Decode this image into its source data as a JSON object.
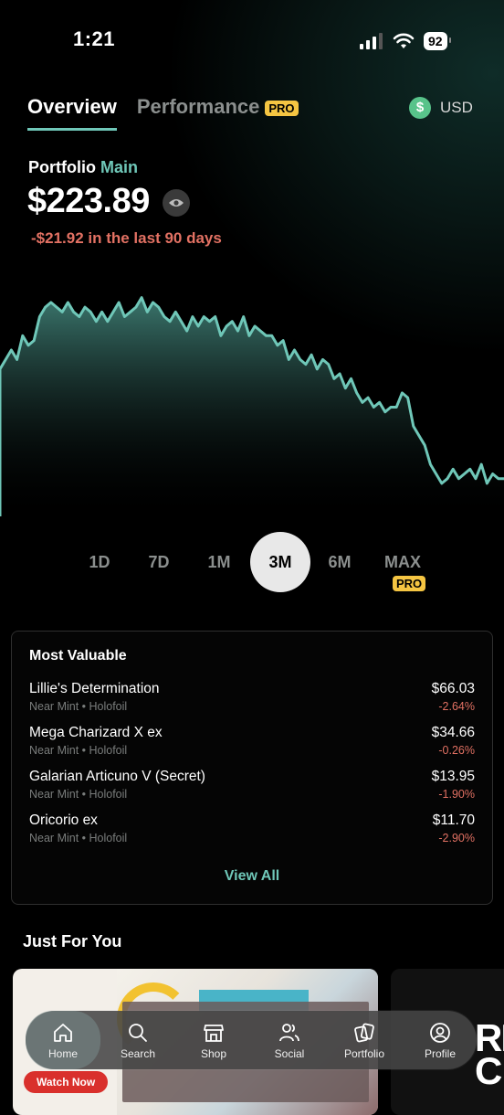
{
  "status_bar": {
    "time": "1:21",
    "battery": "92"
  },
  "tabs": [
    {
      "label": "Overview",
      "active": true
    },
    {
      "label": "Performance",
      "badge": "PRO",
      "active": false
    }
  ],
  "currency": {
    "icon": "dollar-icon",
    "symbol": "$",
    "label": "USD",
    "color": "#58c38a"
  },
  "portfolio": {
    "label": "Portfolio",
    "name": "Main",
    "value": "$223.89",
    "change_text": "-$21.92 in the last 90 days"
  },
  "accent_color": "#6fc7b8",
  "negative_color": "#e27163",
  "chart_data": {
    "type": "area",
    "x": [
      1,
      2,
      3,
      4,
      5,
      6,
      7,
      8,
      9,
      10,
      11,
      12,
      13,
      14,
      15,
      16,
      17,
      18,
      19,
      20,
      21,
      22,
      23,
      24,
      25,
      26,
      27,
      28,
      29,
      30,
      31,
      32,
      33,
      34,
      35,
      36,
      37,
      38,
      39,
      40,
      41,
      42,
      43,
      44,
      45,
      46,
      47,
      48,
      49,
      50,
      51,
      52,
      53,
      54,
      55,
      56,
      57,
      58,
      59,
      60,
      61,
      62,
      63,
      64,
      65,
      66,
      67,
      68,
      69,
      70,
      71,
      72,
      73,
      74,
      75,
      76,
      77,
      78,
      79,
      80,
      81,
      82,
      83,
      84,
      85,
      86,
      87,
      88,
      89,
      90
    ],
    "values": [
      234,
      236,
      238,
      236,
      241,
      239,
      240,
      245,
      247,
      248,
      247,
      246,
      248,
      246,
      245,
      247,
      246,
      244,
      246,
      244,
      246,
      248,
      245,
      246,
      247,
      249,
      246,
      248,
      247,
      245,
      244,
      246,
      244,
      242,
      245,
      243,
      245,
      244,
      245,
      241,
      243,
      244,
      242,
      245,
      241,
      243,
      242,
      241,
      241,
      239,
      240,
      236,
      238,
      236,
      235,
      237,
      234,
      236,
      235,
      232,
      233,
      230,
      232,
      229,
      227,
      228,
      226,
      227,
      225,
      226,
      226,
      229,
      228,
      222,
      220,
      218,
      214,
      212,
      210,
      211,
      213,
      211,
      212,
      213,
      211,
      214,
      210,
      212,
      211,
      211
    ],
    "title": "",
    "xlabel": "",
    "ylabel": "",
    "grid": false,
    "line_color": "#6fc7b8"
  },
  "ranges": [
    {
      "label": "1D",
      "active": false
    },
    {
      "label": "7D",
      "active": false
    },
    {
      "label": "1M",
      "active": false
    },
    {
      "label": "3M",
      "active": true
    },
    {
      "label": "6M",
      "active": false
    },
    {
      "label": "MAX",
      "active": false,
      "badge": "PRO"
    }
  ],
  "most_valuable": {
    "title": "Most Valuable",
    "items": [
      {
        "name": "Lillie's Determination",
        "sub": "Near Mint • Holofoil",
        "price": "$66.03",
        "change": "-2.64%"
      },
      {
        "name": "Mega Charizard X ex",
        "sub": "Near Mint • Holofoil",
        "price": "$34.66",
        "change": "-0.26%"
      },
      {
        "name": "Galarian Articuno V (Secret)",
        "sub": "Near Mint • Holofoil",
        "price": "$13.95",
        "change": "-1.90%"
      },
      {
        "name": "Oricorio ex",
        "sub": "Near Mint • Holofoil",
        "price": "$11.70",
        "change": "-2.90%"
      }
    ],
    "view_all": "View All"
  },
  "just_for_you": {
    "title": "Just For You",
    "cta": "Watch Now",
    "second_card_text": "RI\nC"
  },
  "nav": [
    {
      "label": "Home",
      "icon": "home-icon",
      "active": true
    },
    {
      "label": "Search",
      "icon": "search-icon",
      "active": false
    },
    {
      "label": "Shop",
      "icon": "shop-icon",
      "active": false
    },
    {
      "label": "Social",
      "icon": "social-icon",
      "active": false
    },
    {
      "label": "Portfolio",
      "icon": "portfolio-icon",
      "active": false
    },
    {
      "label": "Profile",
      "icon": "profile-icon",
      "active": false
    }
  ]
}
